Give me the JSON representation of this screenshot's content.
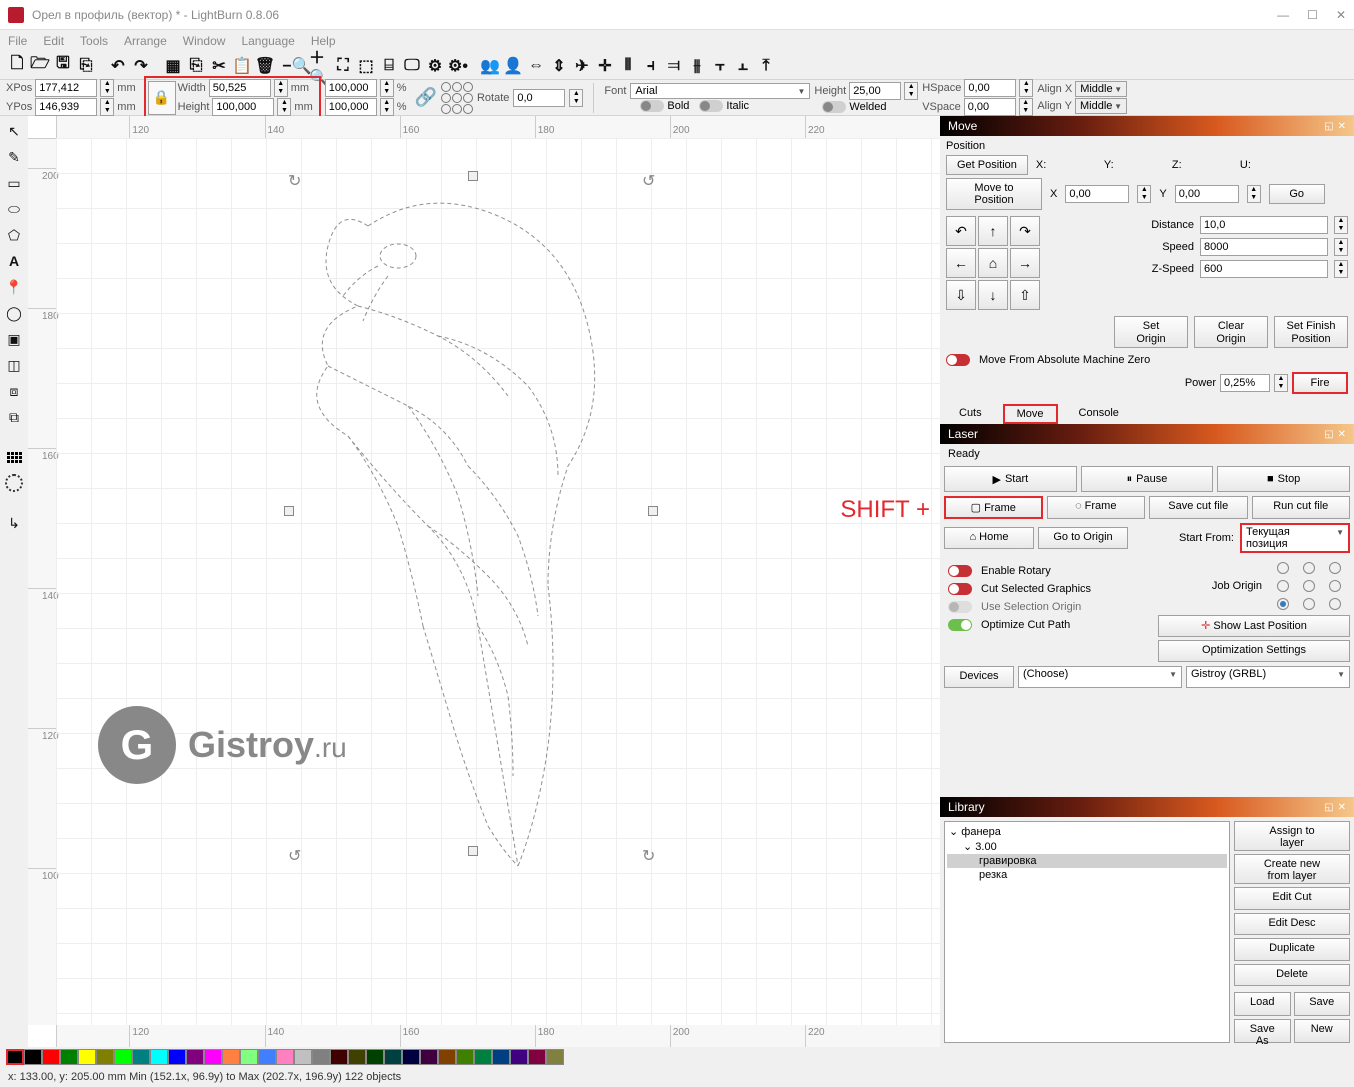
{
  "window": {
    "title": "Орел в профиль (вектор) * - LightBurn 0.8.06"
  },
  "menu": [
    "File",
    "Edit",
    "Tools",
    "Arrange",
    "Window",
    "Language",
    "Help"
  ],
  "props": {
    "xpos_label": "XPos",
    "xpos_value": "177,412",
    "ypos_label": "YPos",
    "ypos_value": "146,939",
    "unit": "mm",
    "width_label": "Width",
    "width_value": "50,525",
    "height_label": "Height",
    "height_value": "100,000",
    "scale1": "100,000",
    "scale2": "100,000",
    "percent": "%",
    "rotate_label": "Rotate",
    "rotate_value": "0,0",
    "font_label": "Font",
    "font_value": "Arial",
    "bold": "Bold",
    "italic": "Italic",
    "text_height_label": "Height",
    "text_height_value": "25,00",
    "welded": "Welded",
    "hspace_label": "HSpace",
    "hspace_value": "0,00",
    "vspace_label": "VSpace",
    "vspace_value": "0,00",
    "alignx_label": "Align X",
    "alignx_value": "Middle",
    "aligny_label": "Align Y",
    "aligny_value": "Middle"
  },
  "ruler_h": [
    "120",
    "140",
    "160",
    "180",
    "200",
    "220"
  ],
  "ruler_v": [
    "200",
    "180",
    "160",
    "140",
    "120",
    "100"
  ],
  "watermark": {
    "logo": "G",
    "text_main": "Gistroy",
    "text_suffix": ".ru"
  },
  "shift_annotation": "SHIFT +",
  "move_panel": {
    "title": "Move",
    "position_label": "Position",
    "get_position": "Get Position",
    "x_label": "X:",
    "y_label": "Y:",
    "z_label": "Z:",
    "u_label": "U:",
    "move_to_position": "Move to Position",
    "x_val": "0,00",
    "y_val": "0,00",
    "go": "Go",
    "distance_label": "Distance",
    "distance_value": "10,0",
    "speed_label": "Speed",
    "speed_value": "8000",
    "zspeed_label": "Z-Speed",
    "zspeed_value": "600",
    "set_origin": "Set\nOrigin",
    "clear_origin": "Clear\nOrigin",
    "set_finish": "Set Finish\nPosition",
    "move_from_zero": "Move From Absolute Machine Zero",
    "power_label": "Power",
    "power_value": "0,25%",
    "fire": "Fire"
  },
  "tabs": {
    "cuts": "Cuts",
    "move": "Move",
    "console": "Console"
  },
  "laser_panel": {
    "title": "Laser",
    "status": "Ready",
    "start": "Start",
    "pause": "Pause",
    "stop": "Stop",
    "frame1": "Frame",
    "frame2": "Frame",
    "save_cut": "Save cut file",
    "run_cut": "Run cut file",
    "home": "Home",
    "goto_origin": "Go to Origin",
    "start_from_label": "Start From:",
    "start_from_value": "Текущая позиция",
    "enable_rotary": "Enable Rotary",
    "cut_selected": "Cut Selected Graphics",
    "use_selection_origin": "Use Selection Origin",
    "optimize_cut": "Optimize Cut Path",
    "job_origin": "Job Origin",
    "show_last": "Show Last Position",
    "optimization": "Optimization Settings",
    "devices": "Devices",
    "choose": "(Choose)",
    "machine": "Gistroy (GRBL)"
  },
  "library_panel": {
    "title": "Library",
    "tree": {
      "root": "фанера",
      "child": "3.00",
      "leaf1": "гравировка",
      "leaf2": "резка"
    },
    "assign": "Assign to\nlayer",
    "create_new": "Create new\nfrom layer",
    "edit_cut": "Edit Cut",
    "edit_desc": "Edit Desc",
    "duplicate": "Duplicate",
    "delete": "Delete",
    "load": "Load",
    "save": "Save",
    "save_as": "Save As",
    "new": "New"
  },
  "colors": [
    "#000000",
    "#ff0000",
    "#008000",
    "#ffff00",
    "#808000",
    "#00ff00",
    "#008080",
    "#00ffff",
    "#0000ff",
    "#800080",
    "#ff00ff",
    "#ff8040",
    "#80ff80",
    "#4080ff",
    "#ff80c0",
    "#c0c0c0",
    "#808080",
    "#400000",
    "#404000",
    "#004000",
    "#004040",
    "#000040",
    "#400040",
    "#804000",
    "#408000",
    "#008040",
    "#004080",
    "#400080",
    "#800040",
    "#808040"
  ],
  "status": "x: 133.00, y: 205.00 mm   Min (152.1x, 96.9y) to Max (202.7x, 196.9y)  122 objects"
}
